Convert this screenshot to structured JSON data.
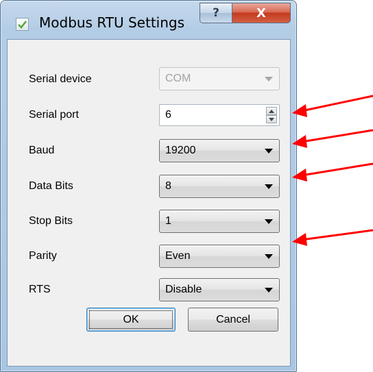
{
  "window": {
    "title": "Modbus RTU Settings",
    "help_glyph": "?",
    "close_glyph": "X"
  },
  "form": {
    "rows": [
      {
        "label": "Serial device",
        "value": "COM",
        "control": "combo-disabled"
      },
      {
        "label": "Serial port",
        "value": "6",
        "control": "spinbox"
      },
      {
        "label": "Baud",
        "value": "19200",
        "control": "combo"
      },
      {
        "label": "Data Bits",
        "value": "8",
        "control": "combo"
      },
      {
        "label": "Stop Bits",
        "value": "1",
        "control": "combo"
      },
      {
        "label": "Parity",
        "value": "Even",
        "control": "combo"
      },
      {
        "label": "RTS",
        "value": "Disable",
        "control": "combo"
      }
    ]
  },
  "buttons": {
    "ok": "OK",
    "cancel": "Cancel"
  },
  "annotations": {
    "arrow_color": "#ff0000",
    "pointed_rows": [
      "Serial port",
      "Baud",
      "Data Bits",
      "Parity"
    ]
  },
  "colors": {
    "accent": "#3c7fb1",
    "frame": "#b4cde6",
    "close": "#c43b1f"
  },
  "icons": [
    "checkbox-app-icon",
    "help-icon",
    "close-icon",
    "dropdown-arrow-icon",
    "spin-up-icon",
    "spin-down-icon",
    "red-arrow-icon"
  ]
}
